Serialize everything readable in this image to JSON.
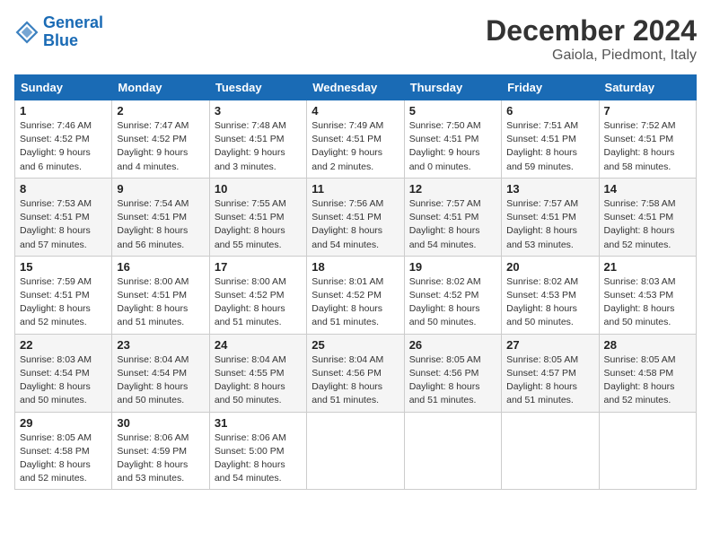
{
  "logo": {
    "line1": "General",
    "line2": "Blue"
  },
  "title": "December 2024",
  "subtitle": "Gaiola, Piedmont, Italy",
  "headers": [
    "Sunday",
    "Monday",
    "Tuesday",
    "Wednesday",
    "Thursday",
    "Friday",
    "Saturday"
  ],
  "weeks": [
    [
      {
        "day": "1",
        "rise": "7:46 AM",
        "set": "4:52 PM",
        "daylight": "9 hours and 6 minutes."
      },
      {
        "day": "2",
        "rise": "7:47 AM",
        "set": "4:52 PM",
        "daylight": "9 hours and 4 minutes."
      },
      {
        "day": "3",
        "rise": "7:48 AM",
        "set": "4:51 PM",
        "daylight": "9 hours and 3 minutes."
      },
      {
        "day": "4",
        "rise": "7:49 AM",
        "set": "4:51 PM",
        "daylight": "9 hours and 2 minutes."
      },
      {
        "day": "5",
        "rise": "7:50 AM",
        "set": "4:51 PM",
        "daylight": "9 hours and 0 minutes."
      },
      {
        "day": "6",
        "rise": "7:51 AM",
        "set": "4:51 PM",
        "daylight": "8 hours and 59 minutes."
      },
      {
        "day": "7",
        "rise": "7:52 AM",
        "set": "4:51 PM",
        "daylight": "8 hours and 58 minutes."
      }
    ],
    [
      {
        "day": "8",
        "rise": "7:53 AM",
        "set": "4:51 PM",
        "daylight": "8 hours and 57 minutes."
      },
      {
        "day": "9",
        "rise": "7:54 AM",
        "set": "4:51 PM",
        "daylight": "8 hours and 56 minutes."
      },
      {
        "day": "10",
        "rise": "7:55 AM",
        "set": "4:51 PM",
        "daylight": "8 hours and 55 minutes."
      },
      {
        "day": "11",
        "rise": "7:56 AM",
        "set": "4:51 PM",
        "daylight": "8 hours and 54 minutes."
      },
      {
        "day": "12",
        "rise": "7:57 AM",
        "set": "4:51 PM",
        "daylight": "8 hours and 54 minutes."
      },
      {
        "day": "13",
        "rise": "7:57 AM",
        "set": "4:51 PM",
        "daylight": "8 hours and 53 minutes."
      },
      {
        "day": "14",
        "rise": "7:58 AM",
        "set": "4:51 PM",
        "daylight": "8 hours and 52 minutes."
      }
    ],
    [
      {
        "day": "15",
        "rise": "7:59 AM",
        "set": "4:51 PM",
        "daylight": "8 hours and 52 minutes."
      },
      {
        "day": "16",
        "rise": "8:00 AM",
        "set": "4:51 PM",
        "daylight": "8 hours and 51 minutes."
      },
      {
        "day": "17",
        "rise": "8:00 AM",
        "set": "4:52 PM",
        "daylight": "8 hours and 51 minutes."
      },
      {
        "day": "18",
        "rise": "8:01 AM",
        "set": "4:52 PM",
        "daylight": "8 hours and 51 minutes."
      },
      {
        "day": "19",
        "rise": "8:02 AM",
        "set": "4:52 PM",
        "daylight": "8 hours and 50 minutes."
      },
      {
        "day": "20",
        "rise": "8:02 AM",
        "set": "4:53 PM",
        "daylight": "8 hours and 50 minutes."
      },
      {
        "day": "21",
        "rise": "8:03 AM",
        "set": "4:53 PM",
        "daylight": "8 hours and 50 minutes."
      }
    ],
    [
      {
        "day": "22",
        "rise": "8:03 AM",
        "set": "4:54 PM",
        "daylight": "8 hours and 50 minutes."
      },
      {
        "day": "23",
        "rise": "8:04 AM",
        "set": "4:54 PM",
        "daylight": "8 hours and 50 minutes."
      },
      {
        "day": "24",
        "rise": "8:04 AM",
        "set": "4:55 PM",
        "daylight": "8 hours and 50 minutes."
      },
      {
        "day": "25",
        "rise": "8:04 AM",
        "set": "4:56 PM",
        "daylight": "8 hours and 51 minutes."
      },
      {
        "day": "26",
        "rise": "8:05 AM",
        "set": "4:56 PM",
        "daylight": "8 hours and 51 minutes."
      },
      {
        "day": "27",
        "rise": "8:05 AM",
        "set": "4:57 PM",
        "daylight": "8 hours and 51 minutes."
      },
      {
        "day": "28",
        "rise": "8:05 AM",
        "set": "4:58 PM",
        "daylight": "8 hours and 52 minutes."
      }
    ],
    [
      {
        "day": "29",
        "rise": "8:05 AM",
        "set": "4:58 PM",
        "daylight": "8 hours and 52 minutes."
      },
      {
        "day": "30",
        "rise": "8:06 AM",
        "set": "4:59 PM",
        "daylight": "8 hours and 53 minutes."
      },
      {
        "day": "31",
        "rise": "8:06 AM",
        "set": "5:00 PM",
        "daylight": "8 hours and 54 minutes."
      },
      null,
      null,
      null,
      null
    ]
  ]
}
